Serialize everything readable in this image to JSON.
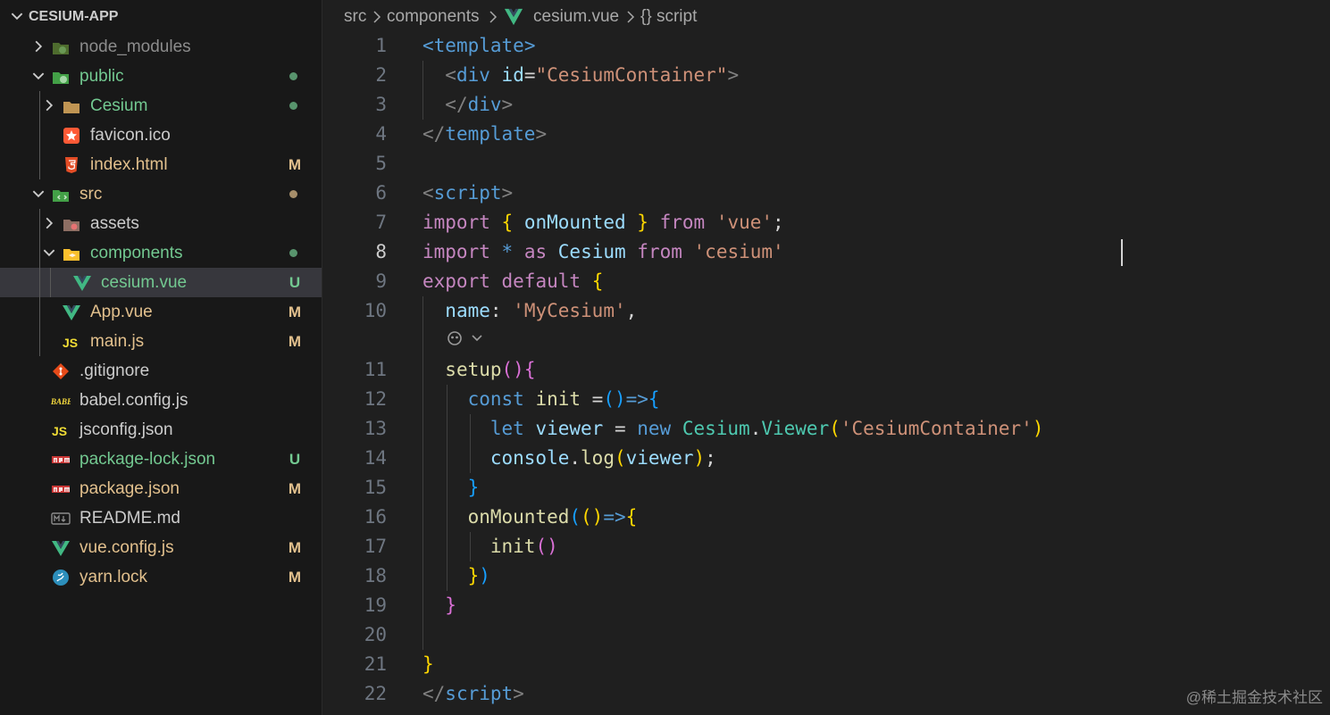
{
  "explorer": {
    "title": "CESIUM-APP",
    "items": [
      {
        "label": "node_modules",
        "color": "#8c8c8c",
        "icon": "node-modules-folder-icon",
        "badge": "",
        "dot": false
      },
      {
        "label": "public",
        "color": "#73c991",
        "icon": "public-folder-icon",
        "badge": "",
        "dot": true
      },
      {
        "label": "Cesium",
        "color": "#73c991",
        "icon": "folder-icon",
        "badge": "",
        "dot": true
      },
      {
        "label": "favicon.ico",
        "color": "#cccccc",
        "icon": "favicon-icon",
        "badge": "",
        "dot": false
      },
      {
        "label": "index.html",
        "color": "#e2c08d",
        "icon": "html5-icon",
        "badge": "M",
        "dot": false
      },
      {
        "label": "src",
        "color": "#e2c08d",
        "icon": "src-folder-icon",
        "badge": "",
        "dot": true
      },
      {
        "label": "assets",
        "color": "#cccccc",
        "icon": "assets-folder-icon",
        "badge": "",
        "dot": false
      },
      {
        "label": "components",
        "color": "#73c991",
        "icon": "components-folder-icon",
        "badge": "",
        "dot": true
      },
      {
        "label": "cesium.vue",
        "color": "#73c991",
        "icon": "vue-icon",
        "badge": "U",
        "dot": false
      },
      {
        "label": "App.vue",
        "color": "#e2c08d",
        "icon": "vue-icon",
        "badge": "M",
        "dot": false
      },
      {
        "label": "main.js",
        "color": "#e2c08d",
        "icon": "javascript-icon",
        "badge": "M",
        "dot": false
      },
      {
        "label": ".gitignore",
        "color": "#cccccc",
        "icon": "git-icon",
        "badge": "",
        "dot": false
      },
      {
        "label": "babel.config.js",
        "color": "#cccccc",
        "icon": "babel-icon",
        "badge": "",
        "dot": false
      },
      {
        "label": "jsconfig.json",
        "color": "#cccccc",
        "icon": "javascript-icon",
        "badge": "",
        "dot": false
      },
      {
        "label": "package-lock.json",
        "color": "#73c991",
        "icon": "npm-icon",
        "badge": "U",
        "dot": false
      },
      {
        "label": "package.json",
        "color": "#e2c08d",
        "icon": "npm-icon",
        "badge": "M",
        "dot": false
      },
      {
        "label": "README.md",
        "color": "#cccccc",
        "icon": "markdown-icon",
        "badge": "",
        "dot": false
      },
      {
        "label": "vue.config.js",
        "color": "#e2c08d",
        "icon": "vue-icon",
        "badge": "M",
        "dot": false
      },
      {
        "label": "yarn.lock",
        "color": "#e2c08d",
        "icon": "yarn-icon",
        "badge": "M",
        "dot": false
      }
    ]
  },
  "breadcrumb": [
    "src",
    "components",
    "cesium.vue",
    "{} script"
  ],
  "editor": {
    "active_line": "8",
    "lines": [
      {
        "n": "1",
        "t": [
          [
            "tag",
            "<"
          ],
          [
            "tag",
            "template"
          ],
          [
            "tag",
            ">"
          ]
        ]
      },
      {
        "n": "2",
        "t": [
          [
            "def",
            "  "
          ],
          [
            "pun",
            "<"
          ],
          [
            "tag",
            "div"
          ],
          [
            "def",
            " "
          ],
          [
            "attr",
            "id"
          ],
          [
            "def",
            "="
          ],
          [
            "str",
            "\"CesiumContainer\""
          ],
          [
            "pun",
            ">"
          ]
        ]
      },
      {
        "n": "3",
        "t": [
          [
            "def",
            "  "
          ],
          [
            "pun",
            "</"
          ],
          [
            "tag",
            "div"
          ],
          [
            "pun",
            ">"
          ]
        ]
      },
      {
        "n": "4",
        "t": [
          [
            "pun",
            "</"
          ],
          [
            "tag",
            "template"
          ],
          [
            "pun",
            ">"
          ]
        ]
      },
      {
        "n": "5",
        "t": []
      },
      {
        "n": "6",
        "t": [
          [
            "pun",
            "<"
          ],
          [
            "tag",
            "script"
          ],
          [
            "pun",
            ">"
          ]
        ]
      },
      {
        "n": "7",
        "t": [
          [
            "kw",
            "import"
          ],
          [
            "def",
            " "
          ],
          [
            "b1",
            "{"
          ],
          [
            "def",
            " "
          ],
          [
            "var",
            "onMounted"
          ],
          [
            "def",
            " "
          ],
          [
            "b1",
            "}"
          ],
          [
            "def",
            " "
          ],
          [
            "kw",
            "from"
          ],
          [
            "def",
            " "
          ],
          [
            "str",
            "'vue'"
          ],
          [
            "def",
            ";"
          ]
        ]
      },
      {
        "n": "8",
        "t": [
          [
            "kw",
            "import"
          ],
          [
            "def",
            " "
          ],
          [
            "sto",
            "*"
          ],
          [
            "def",
            " "
          ],
          [
            "kw",
            "as"
          ],
          [
            "def",
            " "
          ],
          [
            "var",
            "Cesium"
          ],
          [
            "def",
            " "
          ],
          [
            "kw",
            "from"
          ],
          [
            "def",
            " "
          ],
          [
            "str",
            "'cesium'"
          ]
        ]
      },
      {
        "n": "9",
        "t": [
          [
            "kw",
            "export"
          ],
          [
            "def",
            " "
          ],
          [
            "kw",
            "default"
          ],
          [
            "def",
            " "
          ],
          [
            "b1",
            "{"
          ]
        ]
      },
      {
        "n": "10",
        "t": [
          [
            "def",
            "  "
          ],
          [
            "var",
            "name"
          ],
          [
            "def",
            ": "
          ],
          [
            "str",
            "'MyCesium'"
          ],
          [
            "def",
            ","
          ]
        ]
      },
      {
        "n": "",
        "t": []
      },
      {
        "n": "11",
        "t": [
          [
            "def",
            "  "
          ],
          [
            "fn",
            "setup"
          ],
          [
            "b2",
            "()"
          ],
          [
            "b2",
            "{"
          ]
        ]
      },
      {
        "n": "12",
        "t": [
          [
            "def",
            "    "
          ],
          [
            "sto",
            "const"
          ],
          [
            "def",
            " "
          ],
          [
            "fn",
            "init"
          ],
          [
            "def",
            " ="
          ],
          [
            "b3",
            "()"
          ],
          [
            "sto",
            "=>"
          ],
          [
            "b3",
            "{"
          ]
        ]
      },
      {
        "n": "13",
        "t": [
          [
            "def",
            "      "
          ],
          [
            "sto",
            "let"
          ],
          [
            "def",
            " "
          ],
          [
            "var",
            "viewer"
          ],
          [
            "def",
            " = "
          ],
          [
            "sto",
            "new"
          ],
          [
            "def",
            " "
          ],
          [
            "cls",
            "Cesium"
          ],
          [
            "def",
            "."
          ],
          [
            "cls",
            "Viewer"
          ],
          [
            "b1",
            "("
          ],
          [
            "str",
            "'CesiumContainer'"
          ],
          [
            "b1",
            ")"
          ]
        ]
      },
      {
        "n": "14",
        "t": [
          [
            "def",
            "      "
          ],
          [
            "var",
            "console"
          ],
          [
            "def",
            "."
          ],
          [
            "fn",
            "log"
          ],
          [
            "b1",
            "("
          ],
          [
            "var",
            "viewer"
          ],
          [
            "b1",
            ")"
          ],
          [
            "def",
            ";"
          ]
        ]
      },
      {
        "n": "15",
        "t": [
          [
            "def",
            "    "
          ],
          [
            "b3",
            "}"
          ]
        ]
      },
      {
        "n": "16",
        "t": [
          [
            "def",
            "    "
          ],
          [
            "fn",
            "onMounted"
          ],
          [
            "b3",
            "("
          ],
          [
            "b1",
            "()"
          ],
          [
            "sto",
            "=>"
          ],
          [
            "b1",
            "{"
          ]
        ]
      },
      {
        "n": "17",
        "t": [
          [
            "def",
            "      "
          ],
          [
            "fn",
            "init"
          ],
          [
            "b2",
            "()"
          ]
        ]
      },
      {
        "n": "18",
        "t": [
          [
            "def",
            "    "
          ],
          [
            "b1",
            "}"
          ],
          [
            "b3",
            ")"
          ]
        ]
      },
      {
        "n": "19",
        "t": [
          [
            "def",
            "  "
          ],
          [
            "b2",
            "}"
          ]
        ]
      },
      {
        "n": "20",
        "t": []
      },
      {
        "n": "21",
        "t": [
          [
            "b1",
            "}"
          ]
        ]
      },
      {
        "n": "22",
        "t": [
          [
            "pun",
            "</"
          ],
          [
            "tag",
            "script"
          ],
          [
            "pun",
            ">"
          ]
        ]
      }
    ]
  },
  "watermark": "@稀土掘金技术社区"
}
